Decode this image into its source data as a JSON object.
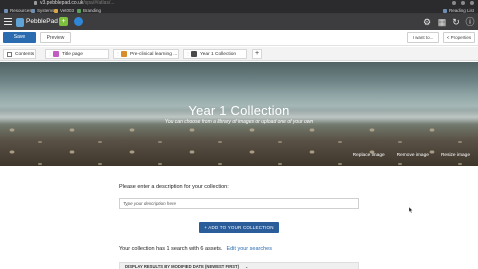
{
  "browser": {
    "url_host": "v3.pebblepad.co.uk",
    "url_rest": "/spa/#/atlas/...",
    "bookmarks": [
      "Resources",
      "Systems",
      "Vet003",
      "Branding"
    ],
    "reading_list": "Reading List"
  },
  "app": {
    "logo_text": "PebblePad",
    "app_icon_glyph": "+",
    "header_icons": [
      "gear-icon",
      "apps-grid-icon",
      "history-icon",
      "info-icon"
    ]
  },
  "toolbar": {
    "save_label": "Save",
    "preview_label": "Preview",
    "i_want_to_label": "I want to...",
    "properties_label": "< Properties"
  },
  "tabs": [
    {
      "label": "Contents"
    },
    {
      "label": "Title page",
      "badge_color": "#c25bc2"
    },
    {
      "label": "Pre-clinical learning ...",
      "badge_color": "#d98c2a"
    },
    {
      "label": "Year 1 Collection",
      "badge_color": "#4a4a4a"
    }
  ],
  "add_tab_label": "+",
  "hero": {
    "title": "Year 1 Collection",
    "subtitle": "You can choose from a library of images or upload one of your own",
    "actions": [
      "Replace image",
      "Remove image",
      "Resize image"
    ]
  },
  "content": {
    "description_label": "Please enter a description for your collection:",
    "description_placeholder": "Type your description here",
    "add_button_label": "+ ADD TO YOUR COLLECTION",
    "search_summary": "Your collection has 1 search with 6 assets.",
    "edit_searches_label": "Edit your searches",
    "sort_label": "DISPLAY RESULTS BY MODIFIED DATE (NEWEST FIRST)"
  }
}
